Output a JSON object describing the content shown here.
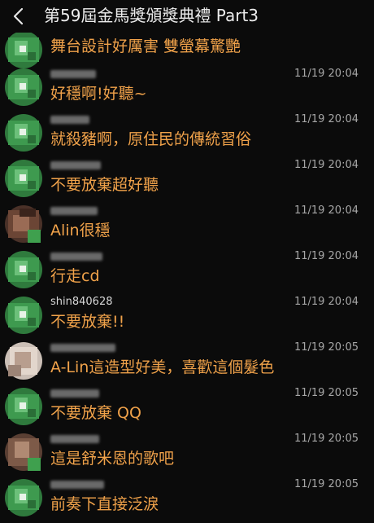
{
  "header": {
    "back_icon": "chevron-left-icon",
    "title": "第59屆金馬獎頒獎典禮 Part3"
  },
  "colors": {
    "background": "#0b0b0b",
    "message_text": "#f0a24a",
    "timestamp": "#a7a7a7",
    "title": "#ededed"
  },
  "messages": [
    {
      "username": "",
      "time": "",
      "text": "舞台設計好厲害 雙螢幕驚艷",
      "avatar": "green"
    },
    {
      "username": "",
      "time": "11/19 20:04",
      "text": "好穩啊!好聽~",
      "avatar": "green"
    },
    {
      "username": "",
      "time": "11/19 20:04",
      "text": "就殺豬啊，原住民的傳統習俗",
      "avatar": "green"
    },
    {
      "username": "",
      "time": "11/19 20:04",
      "text": "不要放棄超好聽",
      "avatar": "green"
    },
    {
      "username": "",
      "time": "11/19 20:04",
      "text": "Alin很穩",
      "avatar": "photo-brown"
    },
    {
      "username": "",
      "time": "11/19 20:04",
      "text": "行走cd",
      "avatar": "green"
    },
    {
      "username": "shin840628",
      "time": "11/19 20:04",
      "text": "不要放棄!!",
      "avatar": "green"
    },
    {
      "username": "",
      "time": "11/19 20:05",
      "text": "A-Lin這造型好美，喜歡這個髮色",
      "avatar": "photo-light"
    },
    {
      "username": "",
      "time": "11/19 20:05",
      "text": "不要放棄 QQ",
      "avatar": "green"
    },
    {
      "username": "",
      "time": "11/19 20:05",
      "text": "這是舒米恩的歌吧",
      "avatar": "photo-brown"
    },
    {
      "username": "",
      "time": "11/19 20:05",
      "text": "前奏下直接泛淚",
      "avatar": "green"
    }
  ]
}
